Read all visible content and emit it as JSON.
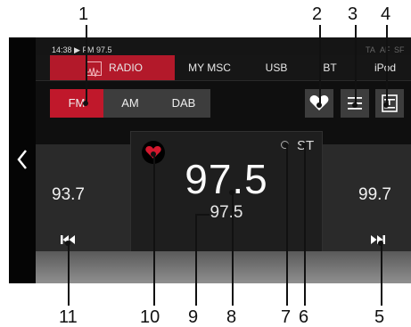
{
  "status_bar": {
    "clock_and_station": "14:38 ▶ FM 97.5",
    "flags": [
      "TA",
      "AF",
      "SF"
    ]
  },
  "tabs": [
    {
      "label": "RADIO",
      "active": true
    },
    {
      "label": "MY MSC",
      "active": false
    },
    {
      "label": "USB",
      "active": false
    },
    {
      "label": "BT",
      "active": false
    },
    {
      "label": "iPod",
      "active": false
    }
  ],
  "bands": [
    {
      "label": "FM",
      "active": true
    },
    {
      "label": "AM",
      "active": false
    },
    {
      "label": "DAB",
      "active": false
    }
  ],
  "stations": {
    "prev_freq": "93.7",
    "current_freq": "97.5",
    "rds_text": "97.5",
    "stereo_indicator": "ST",
    "next_freq": "99.7"
  },
  "callouts": [
    "1",
    "2",
    "3",
    "4",
    "5",
    "6",
    "7",
    "8",
    "9",
    "10",
    "11"
  ],
  "colors": {
    "accent": "#c0182b",
    "screen_bg": "#0f0f0f",
    "button_bg": "#3d3d3d"
  },
  "icons": {
    "back": "chevron-left-icon",
    "favorite": "heart-icon",
    "list": "list-icon",
    "text": "text-info-icon",
    "prev": "skip-previous-icon",
    "next": "skip-next-icon",
    "radio": "radio-wave-icon"
  }
}
